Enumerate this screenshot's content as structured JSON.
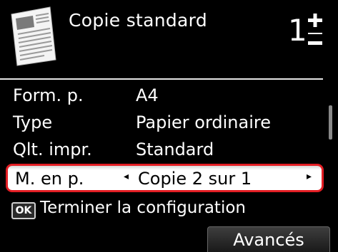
{
  "header": {
    "title": "Copie standard",
    "copies": "1",
    "doc_icon": "document-thumbnail-icon",
    "stepper_icon": "plus-minus-stepper-icon"
  },
  "settings": [
    {
      "label": "Form. p.",
      "value": "A4"
    },
    {
      "label": "Type",
      "value": "Papier ordinaire"
    },
    {
      "label": "Qlt. impr.",
      "value": "Standard"
    }
  ],
  "selected_setting": {
    "label": "M. en p.",
    "value": "Copie 2 sur 1",
    "arrow_left": "◂",
    "arrow_right": "▸"
  },
  "ok_hint": {
    "badge": "OK",
    "text": "Terminer la configuration"
  },
  "buttons": {
    "advanced": "Avancés"
  },
  "colors": {
    "highlight_border": "#e31e24",
    "background": "#000000"
  }
}
